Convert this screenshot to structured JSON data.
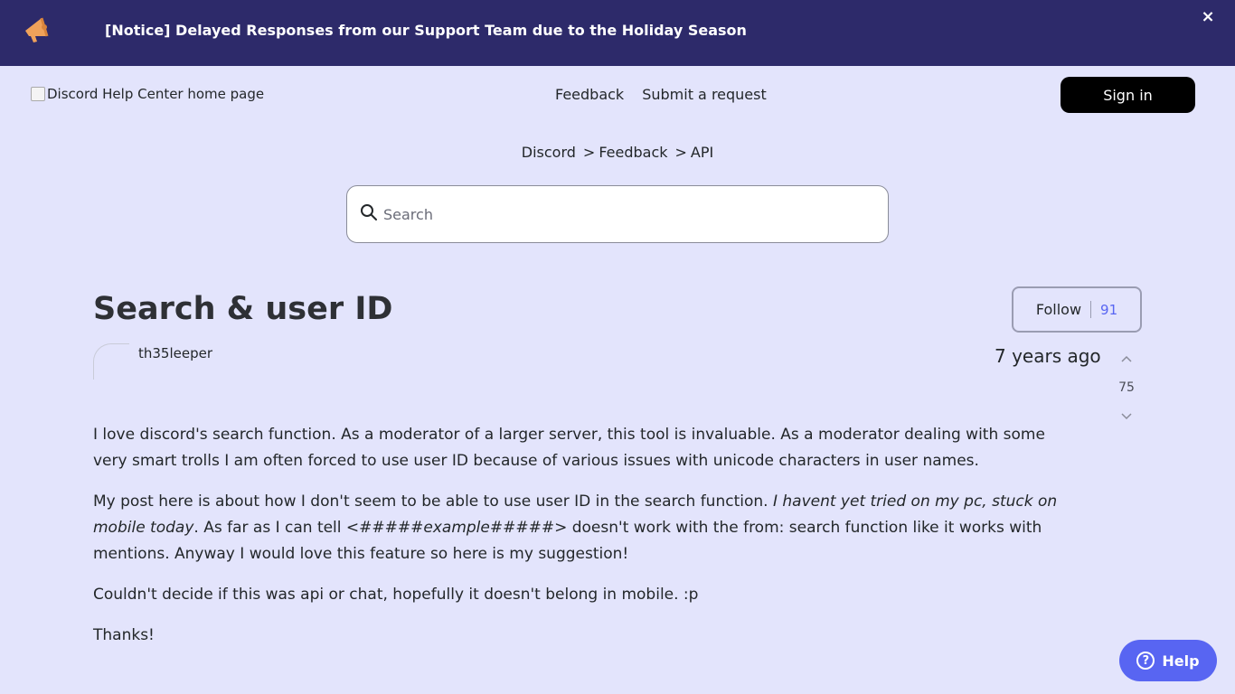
{
  "notice": {
    "text": "[Notice] Delayed Responses from our Support Team due to the Holiday Season",
    "close_label": "×",
    "icon": "megaphone-icon"
  },
  "header": {
    "logo_alt": "Discord Help Center home page",
    "nav": [
      "Feedback",
      "Submit a request"
    ],
    "signin_label": "Sign in"
  },
  "breadcrumb": [
    "Discord",
    "Feedback",
    "API"
  ],
  "search": {
    "placeholder": "Search",
    "value": ""
  },
  "post": {
    "title": "Search & user ID",
    "follow_label": "Follow",
    "follow_count": "91",
    "author": "th35leeper",
    "time": "7 years ago",
    "votes": "75",
    "p1": " I love discord's search function. As a moderator of a larger server, this tool is invaluable. As a moderator dealing with some very smart trolls I am often forced to use user ID because of various issues with unicode characters in user names.",
    "p2_a": "My post here is about how I don't seem to be able to use user ID in the search function. ",
    "p2_em": "I havent yet tried on my pc, stuck on mobile today",
    "p2_b": ". As far as I can tell <#####",
    "p2_em2": "example",
    "p2_c": "#####> doesn't work with the from: search function like it works with mentions. Anyway I would love this feature so here is my suggestion!",
    "p3": "Couldn't decide if this was api or chat, hopefully it doesn't belong in mobile. :p",
    "p4": "Thanks!"
  },
  "help": {
    "label": "Help",
    "q": "?"
  },
  "colors": {
    "notice_bg": "#2d2a6a",
    "page_bg": "#e3e4fc",
    "accent": "#5865f2"
  }
}
